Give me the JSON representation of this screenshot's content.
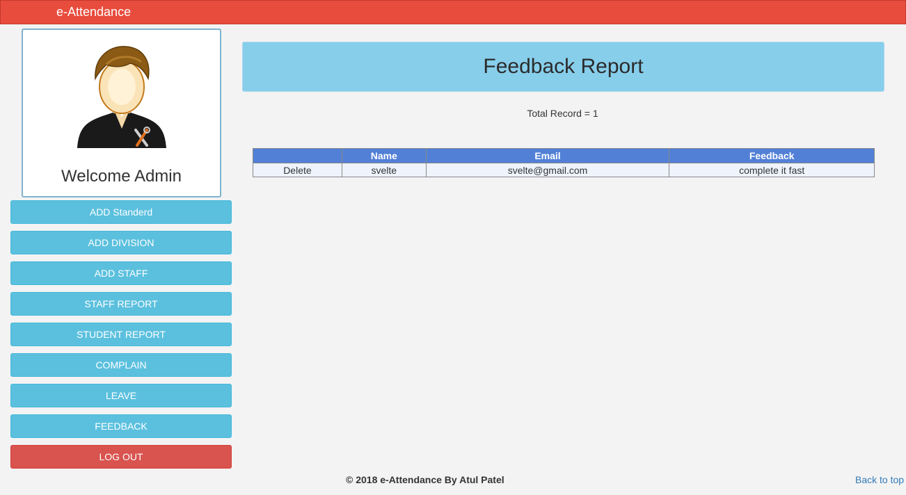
{
  "app": {
    "brand": "e-Attendance"
  },
  "profile": {
    "welcome": "Welcome Admin",
    "avatar_icon": "admin-avatar-icon"
  },
  "sidebar": {
    "items": [
      {
        "label": "ADD Standerd"
      },
      {
        "label": "ADD DIVISION"
      },
      {
        "label": "ADD STAFF"
      },
      {
        "label": "STAFF REPORT"
      },
      {
        "label": "STUDENT REPORT"
      },
      {
        "label": "COMPLAIN"
      },
      {
        "label": "LEAVE"
      },
      {
        "label": "FEEDBACK"
      }
    ],
    "logout": "LOG OUT"
  },
  "main": {
    "title": "Feedback Report",
    "total": "Total Record = 1",
    "table": {
      "headers": [
        "",
        "Name",
        "Email",
        "Feedback"
      ],
      "rows": [
        {
          "action": "Delete",
          "name": "svelte",
          "email": "svelte@gmail.com",
          "feedback": "complete it fast"
        }
      ]
    }
  },
  "footer": {
    "copyright": "© 2018 e-Attendance By Atul Patel",
    "back_to_top": "Back to top"
  },
  "colors": {
    "topbar": "#e84c3d",
    "header_panel": "#87ceeb",
    "nav_button": "#5bc0de",
    "logout_button": "#d9534f",
    "table_header": "#5280d6"
  }
}
